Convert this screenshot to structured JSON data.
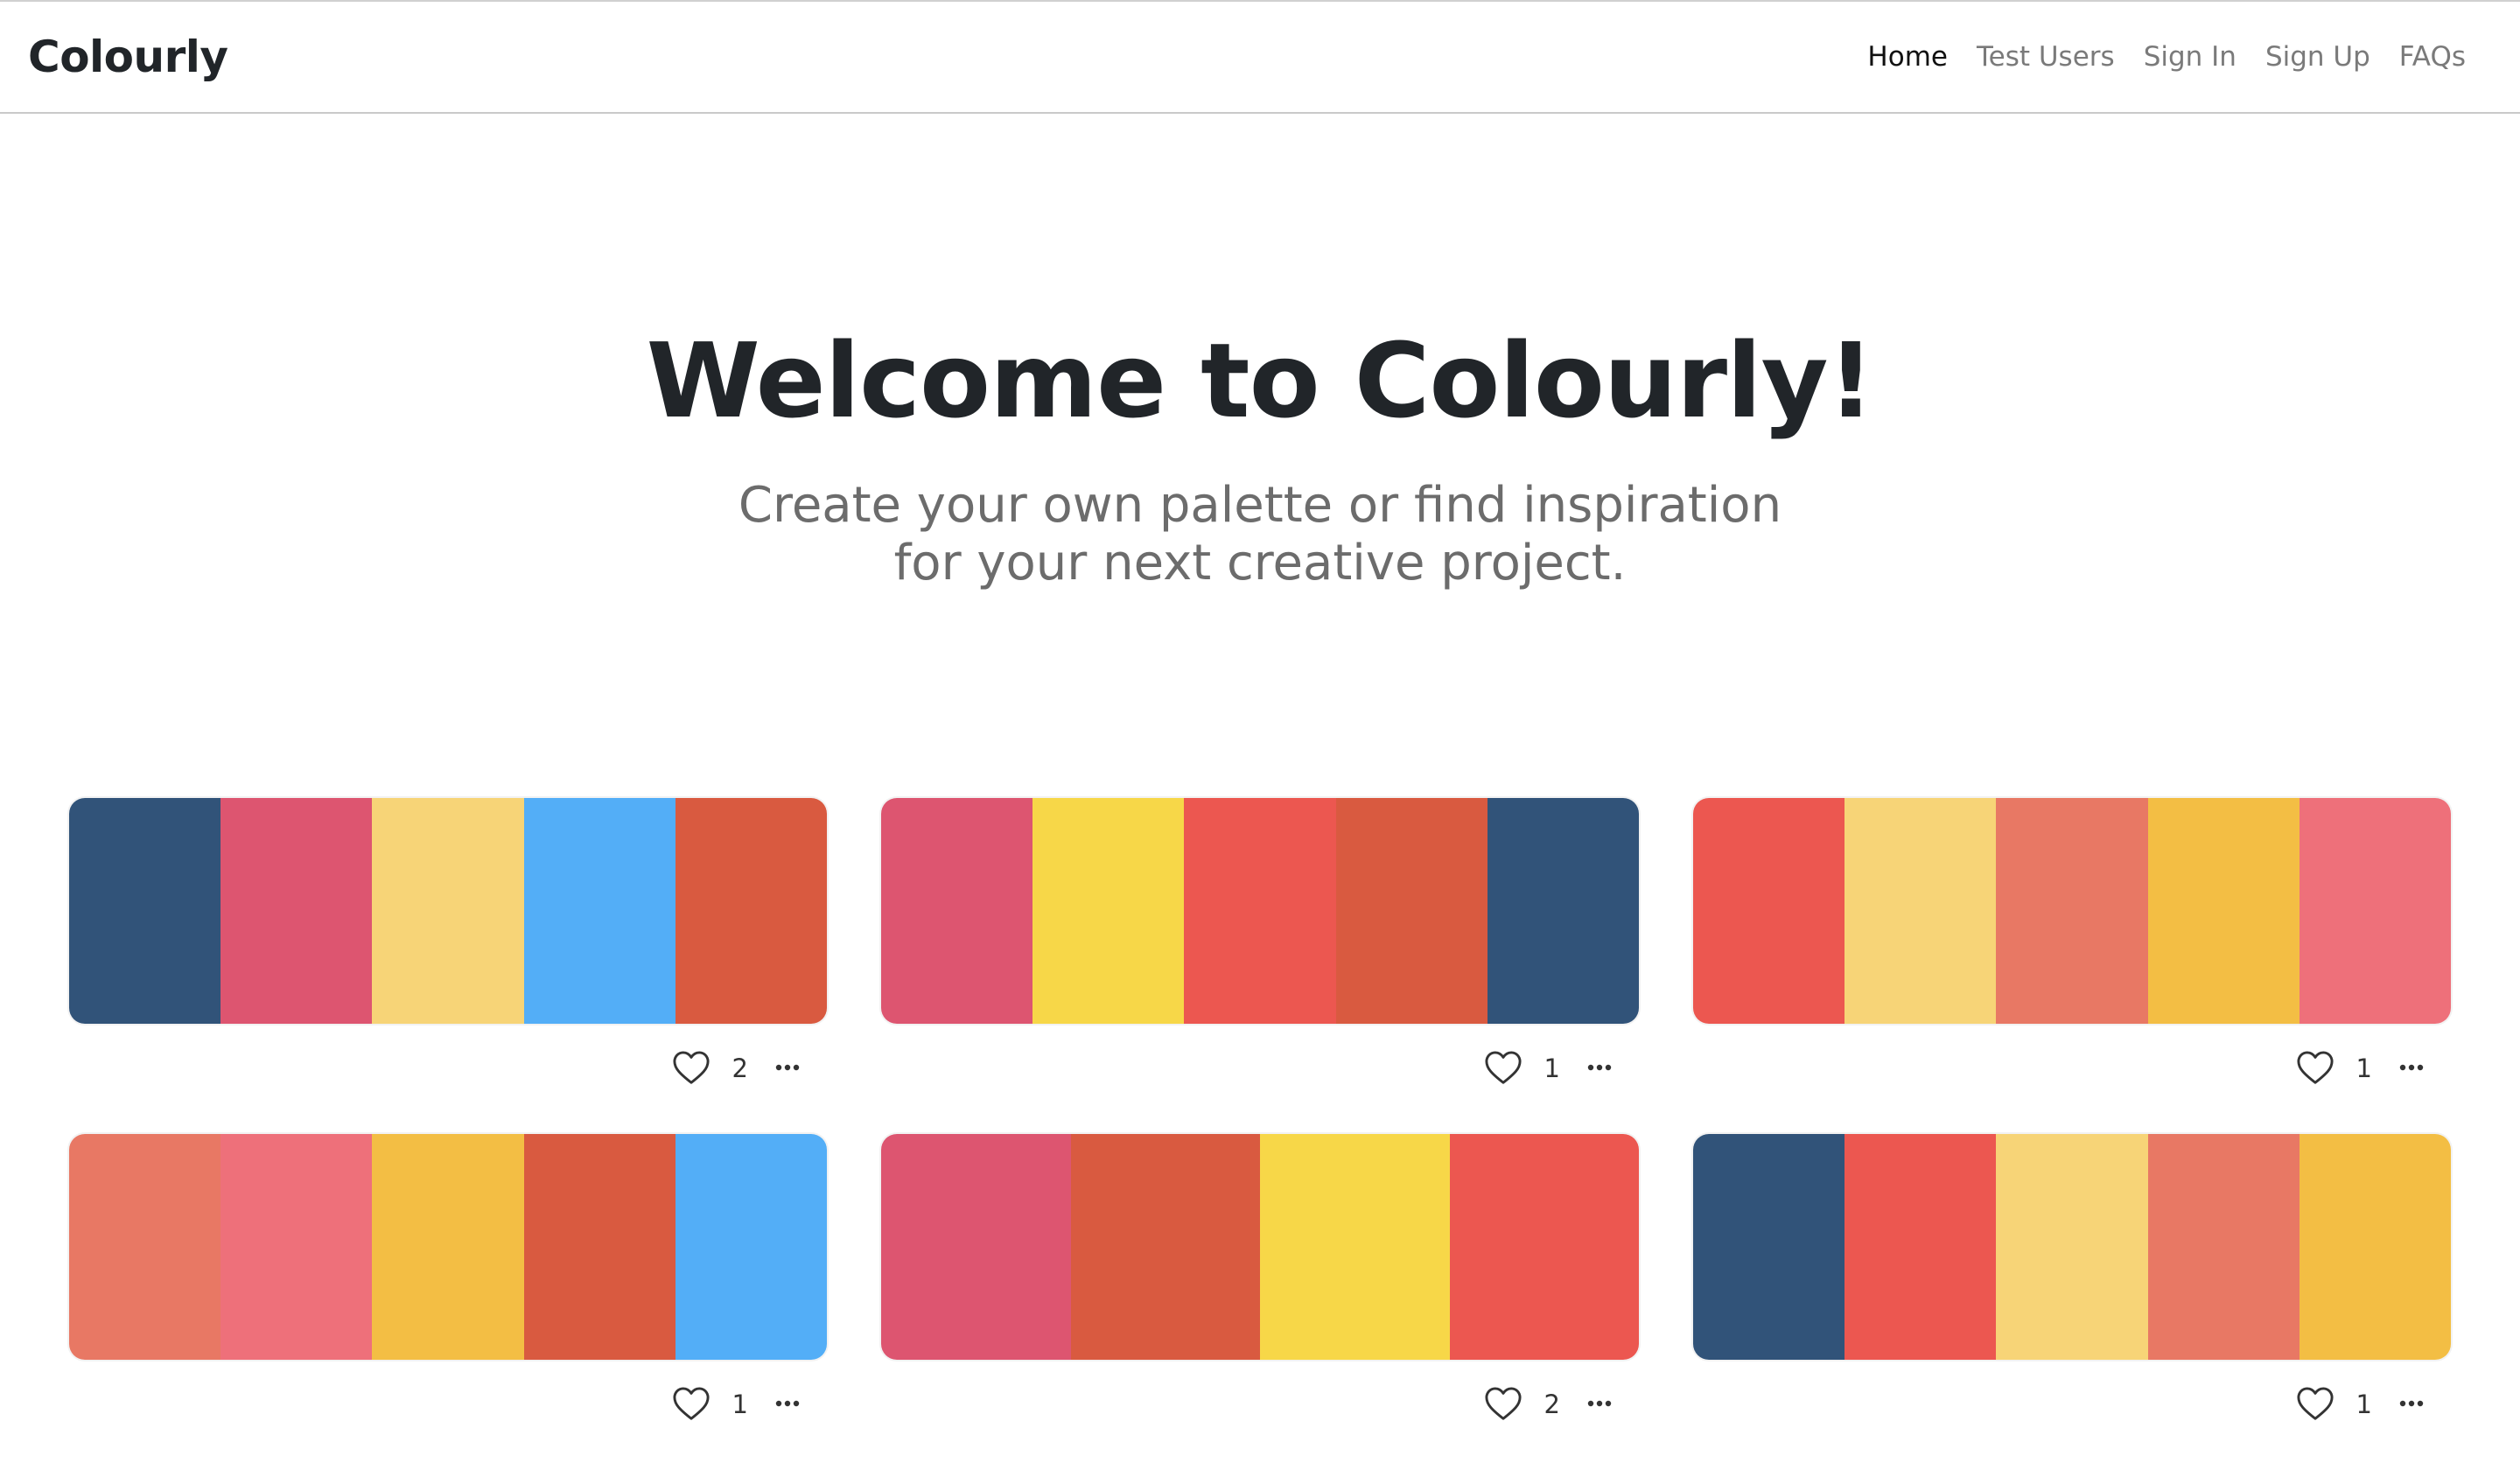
{
  "navbar": {
    "brand": "Colourly",
    "links": [
      {
        "label": "Home",
        "active": true
      },
      {
        "label": "Test Users",
        "active": false
      },
      {
        "label": "Sign In",
        "active": false
      },
      {
        "label": "Sign Up",
        "active": false
      },
      {
        "label": "FAQs",
        "active": false
      }
    ]
  },
  "hero": {
    "title": "Welcome to Colourly!",
    "subtitle": "Create your own palette or find inspiration for your next creative project."
  },
  "palettes": [
    {
      "colors": [
        "#315379",
        "#dd5570",
        "#f7d477",
        "#53aef7",
        "#d95a40"
      ],
      "likes": "2",
      "like_icon": "heart-outline-icon",
      "menu_icon": "ellipsis-icon"
    },
    {
      "colors": [
        "#dd5570",
        "#f7d748",
        "#ec5750",
        "#d95a40",
        "#315379"
      ],
      "likes": "1",
      "like_icon": "heart-outline-icon",
      "menu_icon": "ellipsis-icon"
    },
    {
      "colors": [
        "#ec5750",
        "#f7d477",
        "#e87864",
        "#f3be44",
        "#ee707a"
      ],
      "likes": "1",
      "like_icon": "heart-outline-icon",
      "menu_icon": "ellipsis-icon"
    },
    {
      "colors": [
        "#e87864",
        "#ee707a",
        "#f3be44",
        "#d95a40",
        "#53aef7"
      ],
      "likes": "1",
      "like_icon": "heart-outline-icon",
      "menu_icon": "ellipsis-icon"
    },
    {
      "colors": [
        "#dd5570",
        "#d95a40",
        "#f7d748",
        "#ec5750"
      ],
      "likes": "2",
      "like_icon": "heart-outline-icon",
      "menu_icon": "ellipsis-icon"
    },
    {
      "colors": [
        "#315379",
        "#ec5750",
        "#f7d477",
        "#e87864",
        "#f3be44"
      ],
      "likes": "1",
      "like_icon": "heart-outline-icon",
      "menu_icon": "ellipsis-icon"
    }
  ]
}
